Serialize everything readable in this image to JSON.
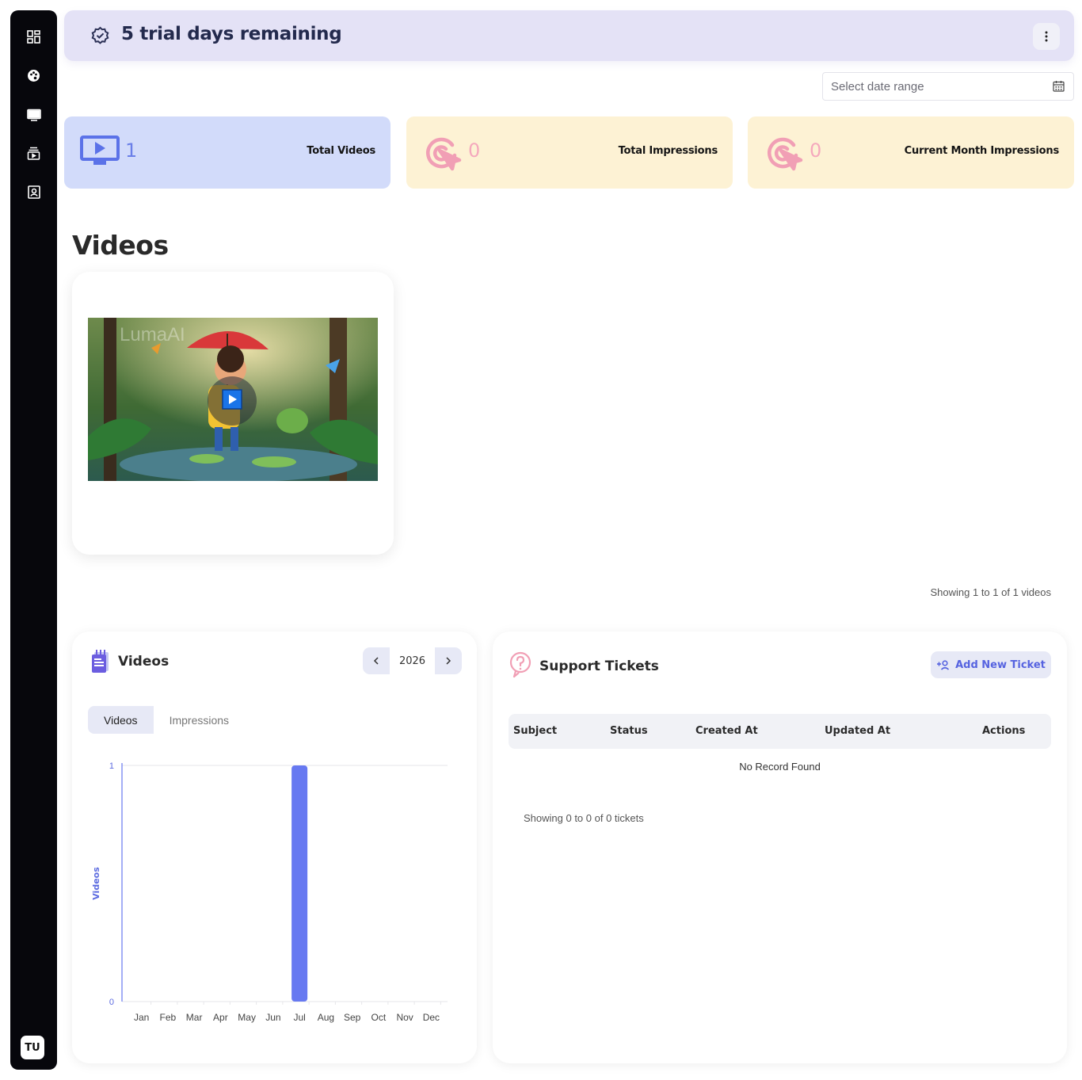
{
  "banner": {
    "title": "5 trial days remaining"
  },
  "date_range": {
    "placeholder": "Select date range"
  },
  "stats": [
    {
      "value": "1",
      "label": "Total Videos",
      "color": "#d2dbfa",
      "accent": "#5b72e8"
    },
    {
      "value": "0",
      "label": "Total Impressions",
      "color": "#fdf2d4",
      "accent": "#f19fb5"
    },
    {
      "value": "0",
      "label": "Current Month Impressions",
      "color": "#fdf2d4",
      "accent": "#f19fb5"
    }
  ],
  "videos": {
    "heading": "Videos",
    "thumbnail_watermark": "LumaAI",
    "showing": "Showing 1 to 1 of 1 videos"
  },
  "chart_panel": {
    "title": "Videos",
    "year": "2026",
    "tabs": [
      "Videos",
      "Impressions"
    ]
  },
  "chart_data": {
    "type": "bar",
    "categories": [
      "Jan",
      "Feb",
      "Mar",
      "Apr",
      "May",
      "Jun",
      "Jul",
      "Aug",
      "Sep",
      "Oct",
      "Nov",
      "Dec"
    ],
    "values": [
      0,
      0,
      0,
      0,
      0,
      0,
      1,
      0,
      0,
      0,
      0,
      0
    ],
    "ylabel": "Videos",
    "yticks": [
      "0",
      "1"
    ],
    "ylim": [
      0,
      1
    ],
    "bar_color": "#6779f1"
  },
  "tickets": {
    "title": "Support Tickets",
    "add_button": "Add New Ticket",
    "columns": [
      "Subject",
      "Status",
      "Created At",
      "Updated At",
      "Actions"
    ],
    "empty_text": "No Record Found",
    "showing": "Showing 0 to 0 of 0 tickets"
  },
  "user": {
    "initials": "TU"
  },
  "icons": {
    "sidebar": [
      "dashboard-icon",
      "palette-icon",
      "monitor-icon",
      "media-library-icon",
      "contact-icon"
    ],
    "banner": "verified-badge-icon",
    "menu": "more-vertical-icon",
    "calendar": "calendar-icon",
    "play": "play-icon"
  }
}
